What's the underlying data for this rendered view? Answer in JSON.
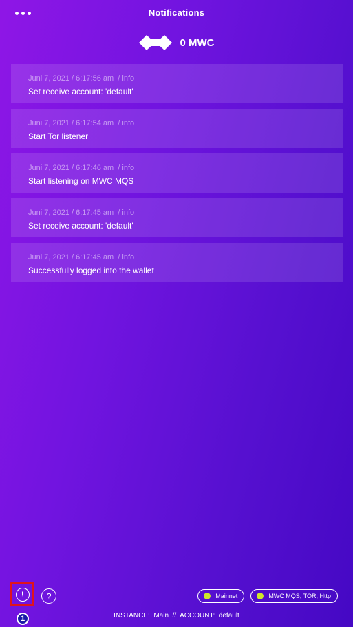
{
  "header": {
    "title": "Notifications",
    "balance": "0 MWC",
    "menu_icon": "more-dots-icon",
    "logo_icon": "mwc-logo-icon"
  },
  "notifications": [
    {
      "timestamp": "Juni 7, 2021 / 6:17:56 am",
      "level": "/ info",
      "message": "Set receive account: 'default'"
    },
    {
      "timestamp": "Juni 7, 2021 / 6:17:54 am",
      "level": "/ info",
      "message": "Start Tor listener"
    },
    {
      "timestamp": "Juni 7, 2021 / 6:17:46 am",
      "level": "/ info",
      "message": "Start listening on MWC MQS"
    },
    {
      "timestamp": "Juni 7, 2021 / 6:17:45 am",
      "level": "/ info",
      "message": "Set receive account: 'default'"
    },
    {
      "timestamp": "Juni 7, 2021 / 6:17:45 am",
      "level": "/ info",
      "message": "Successfully logged into the wallet"
    }
  ],
  "footer": {
    "alert_symbol": "!",
    "help_symbol": "?",
    "badge": "1",
    "status": [
      {
        "label": "Mainnet",
        "color": "#cfe82a"
      },
      {
        "label": "MWC MQS, TOR, Http",
        "color": "#cfe82a"
      }
    ],
    "instance_text": "INSTANCE:  Main  //  ACCOUNT:  default"
  },
  "colors": {
    "gradient_start": "#8f16e6",
    "gradient_end": "#4508c4",
    "alert_border": "#e0141c",
    "badge_bg": "#1a1aa8"
  }
}
